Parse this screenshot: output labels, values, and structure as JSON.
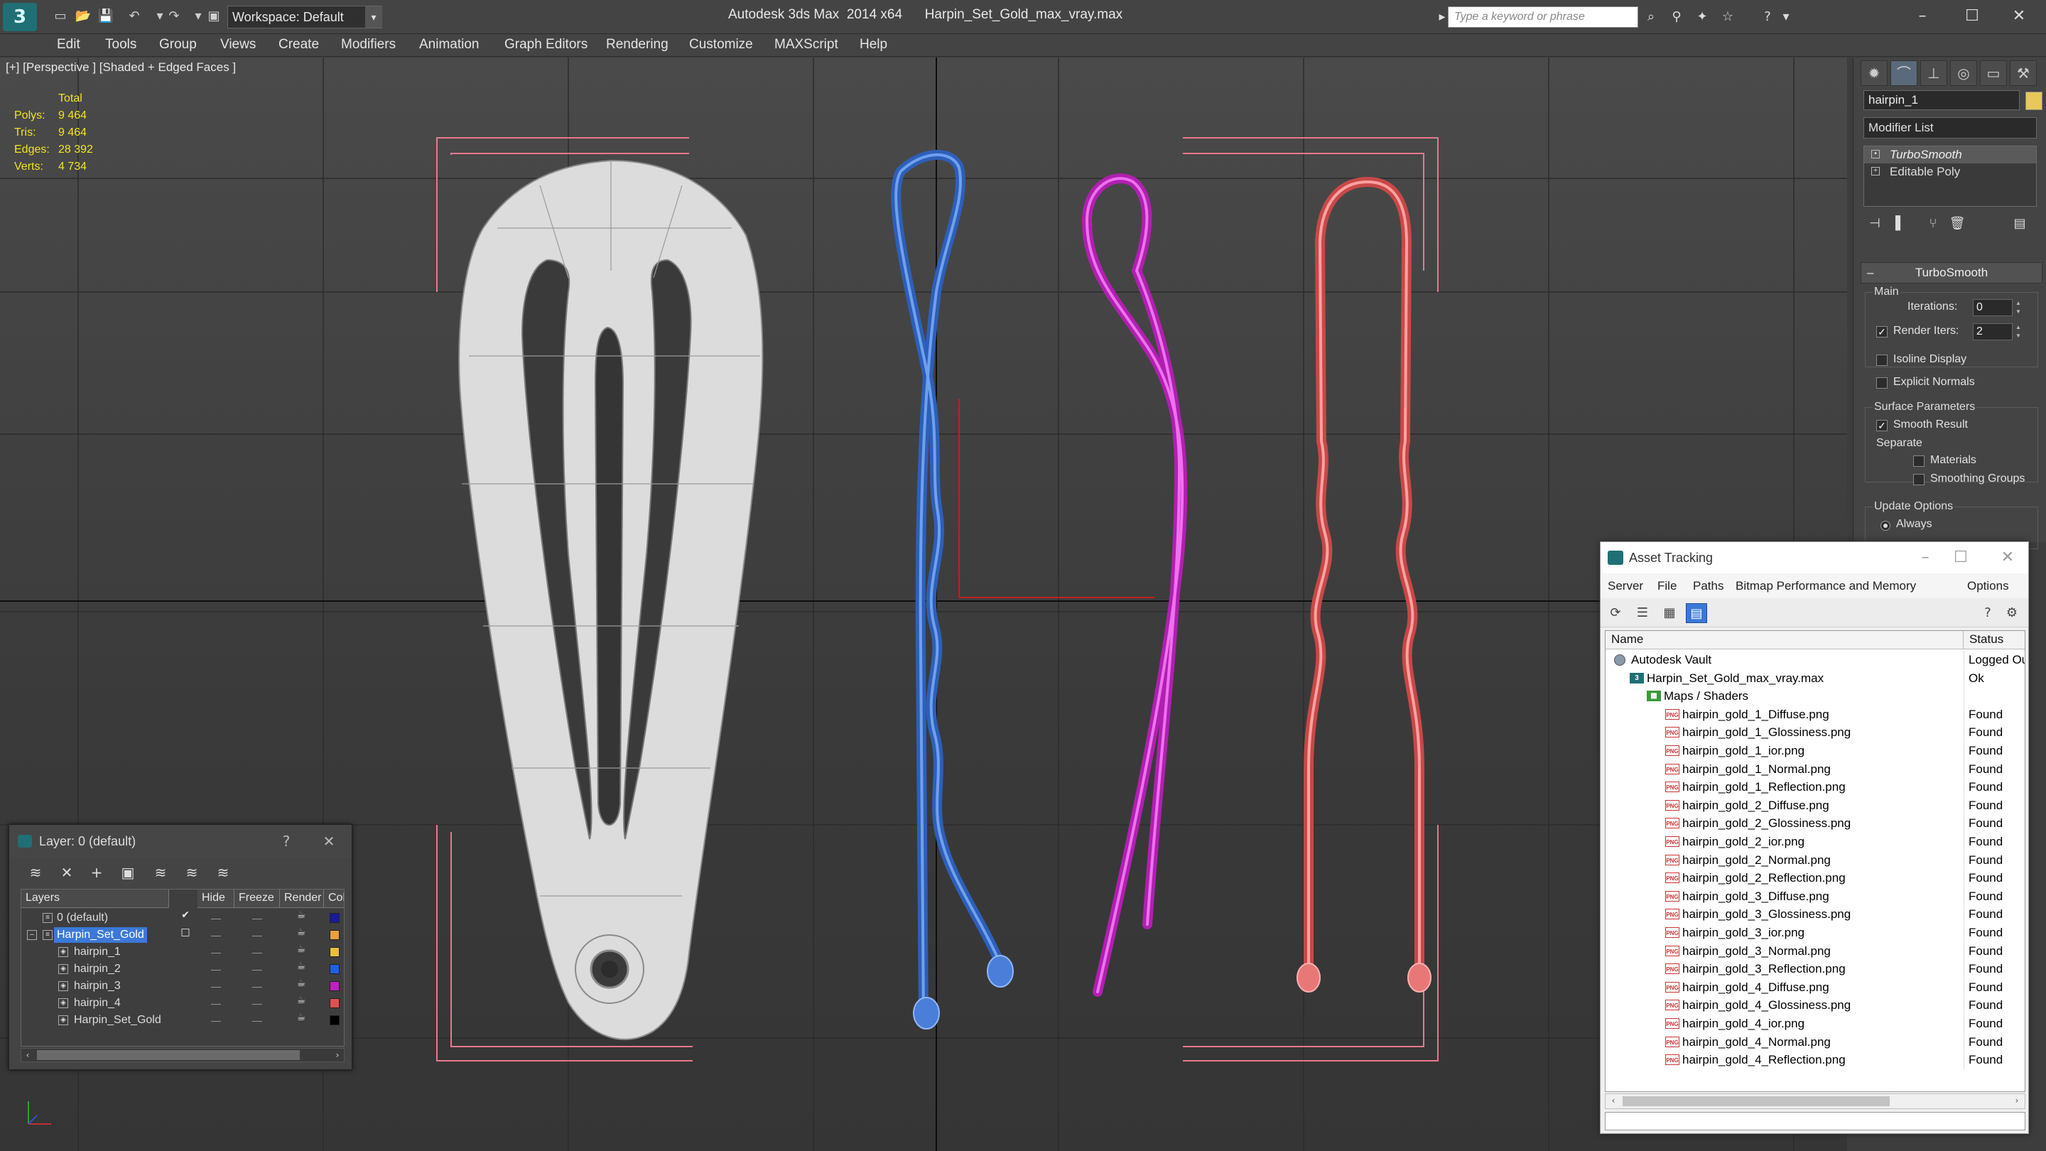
{
  "app": {
    "title": "Autodesk 3ds Max  2014 x64      Harpin_Set_Gold_max_vray.max",
    "logo": "3",
    "workspace_label": "Workspace: Default"
  },
  "search": {
    "placeholder": "Type a keyword or phrase"
  },
  "menu": [
    "Edit",
    "Tools",
    "Group",
    "Views",
    "Create",
    "Modifiers",
    "Animation",
    "Graph Editors",
    "Rendering",
    "Customize",
    "MAXScript",
    "Help"
  ],
  "viewport": {
    "label": "[+] [Perspective ] [Shaded + Edged Faces ]",
    "stats": {
      "total": "Total",
      "rows": [
        {
          "label": "Polys:",
          "value": "9 464"
        },
        {
          "label": "Tris:",
          "value": "9 464"
        },
        {
          "label": "Edges:",
          "value": "28 392"
        },
        {
          "label": "Verts:",
          "value": "4 734"
        }
      ]
    },
    "colors": {
      "clip": "#e6e6e6",
      "blue": "#4a7ed8",
      "magenta": "#d23cd2",
      "red": "#e87878",
      "bracket": "#e7788c"
    }
  },
  "command_panel": {
    "object_name": "hairpin_1",
    "modifier_list": "Modifier List",
    "stack": [
      "TurboSmooth",
      "Editable Poly"
    ],
    "rollout": "TurboSmooth",
    "main": {
      "title": "Main",
      "iterations_label": "Iterations:",
      "iterations": "0",
      "render_iters_label": "Render Iters:",
      "render_iters": "2",
      "isoline": "Isoline Display",
      "explicit_normals": "Explicit Normals"
    },
    "surface": {
      "title": "Surface Parameters",
      "smooth_result": "Smooth Result",
      "separate": "Separate",
      "materials": "Materials",
      "smoothing_groups": "Smoothing Groups"
    },
    "update": {
      "title": "Update Options",
      "always": "Always"
    }
  },
  "layer_window": {
    "title": "Layer: 0 (default)",
    "help": "?",
    "columns": [
      "Layers",
      "Hide",
      "Freeze",
      "Render",
      "Colo"
    ],
    "rows": [
      {
        "name": "0 (default)",
        "color": "#1a1a9a",
        "check": "✔"
      },
      {
        "name": "Harpin_Set_Gold",
        "color": "#e8a040",
        "check": "□"
      },
      {
        "name": "hairpin_1",
        "color": "#e8c040"
      },
      {
        "name": "hairpin_2",
        "color": "#2060e0"
      },
      {
        "name": "hairpin_3",
        "color": "#c020c0"
      },
      {
        "name": "hairpin_4",
        "color": "#e05050"
      },
      {
        "name": "Harpin_Set_Gold",
        "color": "#000000"
      }
    ]
  },
  "asset_tracking": {
    "title": "Asset Tracking",
    "menu": [
      "Server",
      "File",
      "Paths",
      "Bitmap Performance and Memory",
      "Options"
    ],
    "columns": [
      "Name",
      "Status"
    ],
    "rows": [
      {
        "name": "Autodesk Vault",
        "status": "Logged Out",
        "icon": "vault"
      },
      {
        "name": "Harpin_Set_Gold_max_vray.max",
        "status": "Ok",
        "icon": "max"
      },
      {
        "name": "Maps / Shaders",
        "status": "",
        "icon": "maps"
      },
      {
        "name": "hairpin_gold_1_Diffuse.png",
        "status": "Found",
        "icon": "png"
      },
      {
        "name": "hairpin_gold_1_Glossiness.png",
        "status": "Found",
        "icon": "png"
      },
      {
        "name": "hairpin_gold_1_ior.png",
        "status": "Found",
        "icon": "png"
      },
      {
        "name": "hairpin_gold_1_Normal.png",
        "status": "Found",
        "icon": "png"
      },
      {
        "name": "hairpin_gold_1_Reflection.png",
        "status": "Found",
        "icon": "png"
      },
      {
        "name": "hairpin_gold_2_Diffuse.png",
        "status": "Found",
        "icon": "png"
      },
      {
        "name": "hairpin_gold_2_Glossiness.png",
        "status": "Found",
        "icon": "png"
      },
      {
        "name": "hairpin_gold_2_ior.png",
        "status": "Found",
        "icon": "png"
      },
      {
        "name": "hairpin_gold_2_Normal.png",
        "status": "Found",
        "icon": "png"
      },
      {
        "name": "hairpin_gold_2_Reflection.png",
        "status": "Found",
        "icon": "png"
      },
      {
        "name": "hairpin_gold_3_Diffuse.png",
        "status": "Found",
        "icon": "png"
      },
      {
        "name": "hairpin_gold_3_Glossiness.png",
        "status": "Found",
        "icon": "png"
      },
      {
        "name": "hairpin_gold_3_ior.png",
        "status": "Found",
        "icon": "png"
      },
      {
        "name": "hairpin_gold_3_Normal.png",
        "status": "Found",
        "icon": "png"
      },
      {
        "name": "hairpin_gold_3_Reflection.png",
        "status": "Found",
        "icon": "png"
      },
      {
        "name": "hairpin_gold_4_Diffuse.png",
        "status": "Found",
        "icon": "png"
      },
      {
        "name": "hairpin_gold_4_Glossiness.png",
        "status": "Found",
        "icon": "png"
      },
      {
        "name": "hairpin_gold_4_ior.png",
        "status": "Found",
        "icon": "png"
      },
      {
        "name": "hairpin_gold_4_Normal.png",
        "status": "Found",
        "icon": "png"
      },
      {
        "name": "hairpin_gold_4_Reflection.png",
        "status": "Found",
        "icon": "png"
      }
    ]
  }
}
